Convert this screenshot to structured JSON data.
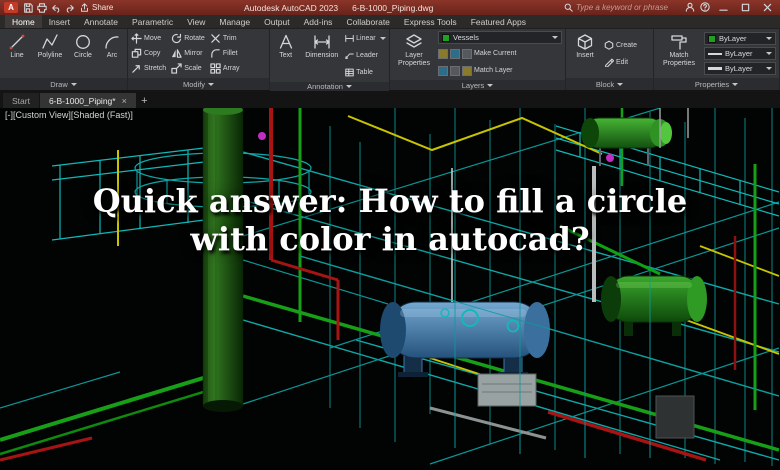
{
  "titlebar": {
    "logo": "A",
    "share_label": "Share",
    "app_title": "Autodesk AutoCAD 2023",
    "doc_title": "6-B-1000_Piping.dwg",
    "search_placeholder": "Type a keyword or phrase"
  },
  "ribbon": {
    "tabs": [
      "Home",
      "Insert",
      "Annotate",
      "Parametric",
      "View",
      "Manage",
      "Output",
      "Add-ins",
      "Collaborate",
      "Express Tools",
      "Featured Apps"
    ],
    "draw": {
      "label": "Draw",
      "line": "Line",
      "polyline": "Polyline",
      "circle": "Circle",
      "arc": "Arc"
    },
    "modify": {
      "label": "Modify",
      "move": "Move",
      "copy": "Copy",
      "stretch": "Stretch",
      "rotate": "Rotate",
      "mirror": "Mirror",
      "scale": "Scale",
      "trim": "Trim",
      "fillet": "Fillet",
      "array": "Array"
    },
    "annotation": {
      "label": "Annotation",
      "text": "Text",
      "dimension": "Dimension",
      "linear": "Linear",
      "leader": "Leader",
      "table": "Table"
    },
    "layers": {
      "label": "Layers",
      "layer_properties": "Layer Properties",
      "current_layer": "Vessels",
      "make_current": "Make Current",
      "match_layer": "Match Layer"
    },
    "block": {
      "label": "Block",
      "insert": "Insert",
      "create": "Create",
      "edit": "Edit"
    },
    "properties": {
      "label": "Properties",
      "match_properties": "Match Properties",
      "bylayer": "ByLayer"
    }
  },
  "filetabs": {
    "start": "Start",
    "document": "6-B-1000_Piping*",
    "close": "×",
    "new_tab": "+"
  },
  "viewport": {
    "controls": {
      "collapse": "[-]",
      "view": "[Custom View]",
      "style": "[Shaded (Fast)]"
    }
  },
  "overlay": {
    "line1": "Quick answer: How to fill a circle",
    "line2": "with color in autocad?"
  },
  "colors": {
    "titlebar_red": "#7c2b21",
    "layer_swatch_green": "#1fa01f",
    "viewport_bg": "#000000"
  }
}
